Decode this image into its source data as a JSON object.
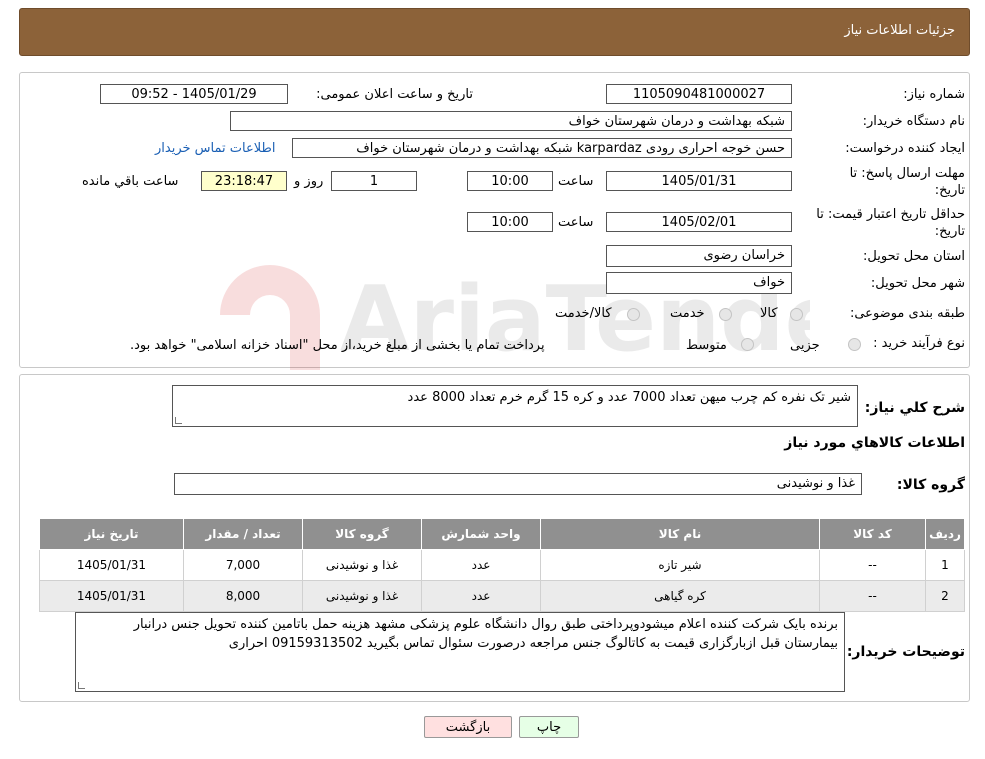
{
  "header": {
    "title": "جزئیات اطلاعات نیاز"
  },
  "form": {
    "need_number_label": "شماره نیاز:",
    "need_number": "1105090481000027",
    "announce_label": "تاریخ و ساعت اعلان عمومی:",
    "announce_value": "1405/01/29 - 09:52",
    "buyer_org_label": "نام دستگاه خریدار:",
    "buyer_org": "شبکه بهداشت و درمان شهرستان خواف",
    "creator_label": "ایجاد کننده درخواست:",
    "creator": "حسن خوجه احراری رودی karpardaz شبکه بهداشت و درمان شهرستان خواف",
    "contact_link": "اطلاعات تماس خریدار",
    "reply_deadline_label": "مهلت ارسال پاسخ: تا تاریخ:",
    "reply_date": "1405/01/31",
    "time_label": "ساعت",
    "reply_time": "10:00",
    "days_value": "1",
    "days_label": "روز و",
    "remaining_time": "23:18:47",
    "remaining_label": "ساعت باقي مانده",
    "validity_label": "حداقل تاریخ اعتبار قیمت: تا تاریخ:",
    "validity_date": "1405/02/01",
    "validity_time": "10:00",
    "province_label": "استان محل تحویل:",
    "province": "خراسان رضوی",
    "city_label": "شهر محل تحویل:",
    "city": "خواف",
    "category_label": "طبقه بندی موضوعی:",
    "category_options": [
      "کالا",
      "خدمت",
      "کالا/خدمت"
    ],
    "process_label": "نوع فرآیند خرید :",
    "process_options": [
      "جزیی",
      "متوسط"
    ],
    "process_note": "پرداخت تمام یا بخشی از مبلغ خرید،از محل \"اسناد خزانه اسلامی\" خواهد بود."
  },
  "details": {
    "summary_label": "شرح کلي نياز:",
    "summary": "شیر تک نفره کم چرب میهن تعداد 7000 عدد و کره 15 گرم خرم تعداد 8000 عدد",
    "goods_info_title": "اطلاعات کالاهاي مورد نياز",
    "group_label": "گروه کالا:",
    "group_value": "غذا و نوشیدنی",
    "table": {
      "headers": [
        "رديف",
        "کد کالا",
        "نام کالا",
        "واحد شمارش",
        "گروه کالا",
        "تعداد / مقدار",
        "تاريخ نياز"
      ],
      "rows": [
        [
          "1",
          "--",
          "شیر تازه",
          "عدد",
          "غذا و نوشیدنی",
          "7,000",
          "1405/01/31"
        ],
        [
          "2",
          "--",
          "کره گیاهی",
          "عدد",
          "غذا و نوشیدنی",
          "8,000",
          "1405/01/31"
        ]
      ]
    },
    "buyer_notes_label": "توضيحات خريدار:",
    "buyer_notes": "برنده بایک شرکت کننده اعلام میشودوپرداختی طبق روال دانشگاه علوم پزشکی مشهد هزینه حمل باتامین کننده تحویل جنس درانبار بیمارستان قبل ازبارگزاری قیمت به کاتالوگ جنس مراجعه درصورت سئوال تماس بگیرید 09159313502 احراری"
  },
  "buttons": {
    "print": "چاپ",
    "back": "بازگشت"
  },
  "colors": {
    "header_bg": "#8c6239",
    "table_header_bg": "#909090",
    "back_button_bg": "#ffe0e0",
    "print_button_bg": "#e6ffe6",
    "remaining_bg": "#ffffcc"
  }
}
